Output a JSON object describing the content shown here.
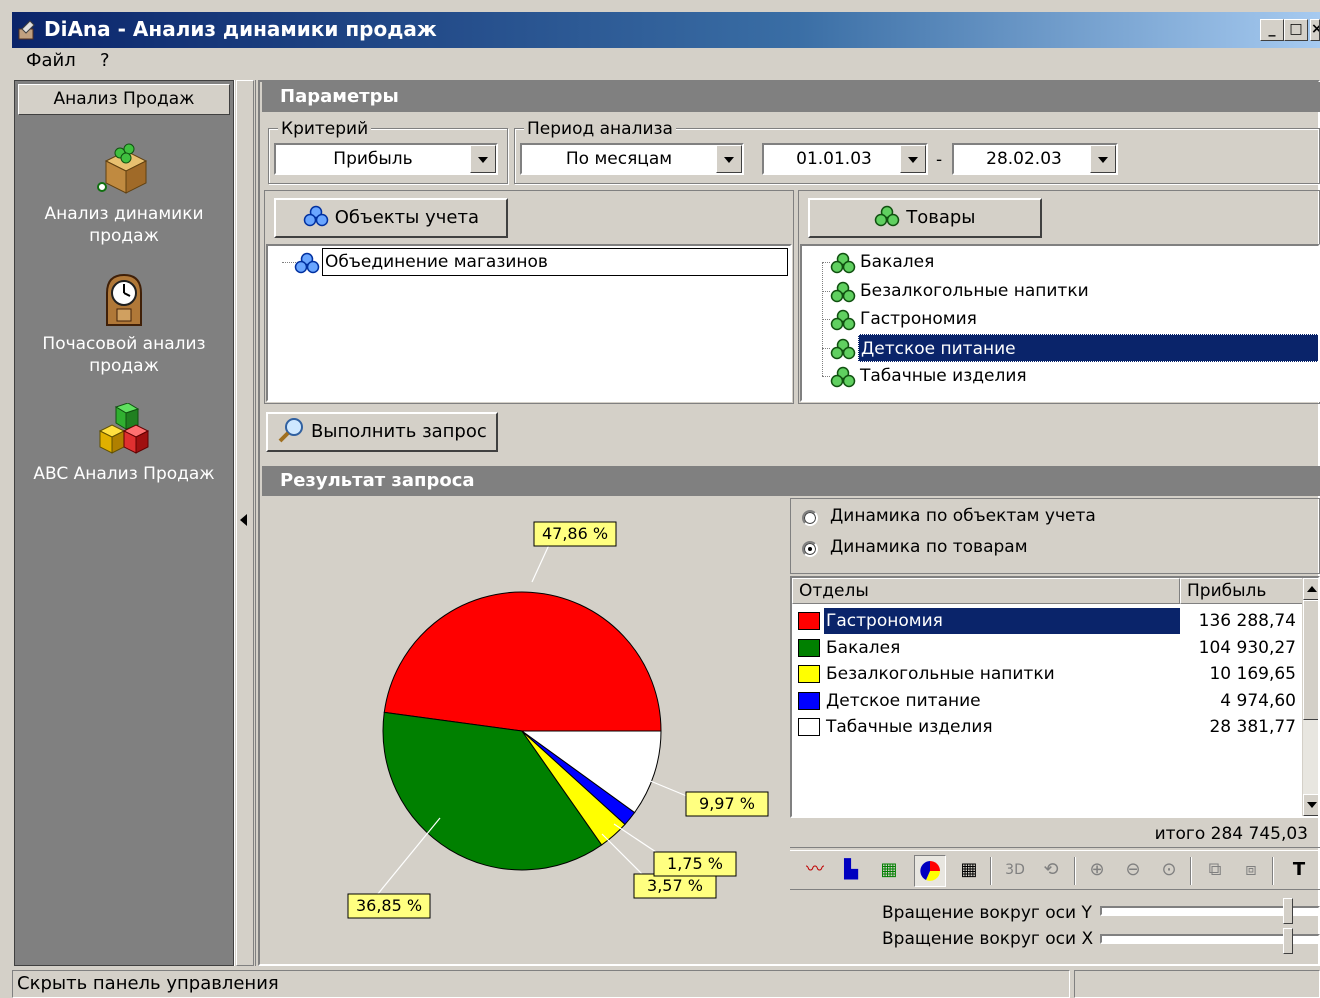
{
  "window": {
    "title": "DiAna - Анализ динамики продаж",
    "controls": {
      "minimize": "_",
      "maximize": "□",
      "close": "×"
    }
  },
  "menu": {
    "items": [
      "Файл",
      "?"
    ]
  },
  "sidebar": {
    "header": "Анализ Продаж",
    "items": [
      {
        "label": "Анализ динамики продаж",
        "icon": "box-icon"
      },
      {
        "label": "Почасовой анализ продаж",
        "icon": "clock-icon"
      },
      {
        "label": "ABC Анализ Продаж",
        "icon": "cubes-icon"
      }
    ]
  },
  "params": {
    "header": "Параметры",
    "criterion": {
      "label": "Критерий",
      "value": "Прибыль"
    },
    "period": {
      "label": "Период анализа",
      "value": "По месяцам"
    },
    "date_from": "01.01.03",
    "date_sep": "-",
    "date_to": "28.02.03",
    "objects_button": "Объекты учета",
    "goods_button": "Товары",
    "objects_tree": [
      "Объединение магазинов"
    ],
    "goods_tree": [
      "Бакалея",
      "Безалкогольные напитки",
      "Гастрономия",
      "Детское питание",
      "Табачные изделия"
    ],
    "goods_selected": "Детское питание",
    "run_button": "Выполнить запрос"
  },
  "result": {
    "header": "Результат запроса",
    "radio_objects": "Динамика по объектам учета",
    "radio_goods": "Динамика по товарам",
    "radio_selected": "goods",
    "grid_header": {
      "name": "Отделы",
      "value": "Прибыль"
    },
    "rows": [
      {
        "name": "Гастрономия",
        "value": "136 288,74",
        "color": "#ff0000",
        "selected": true
      },
      {
        "name": "Бакалея",
        "value": "104 930,27",
        "color": "#008000",
        "selected": false
      },
      {
        "name": "Безалкогольные напитки",
        "value": "10 169,65",
        "color": "#ffff00",
        "selected": false
      },
      {
        "name": "Детское питание",
        "value": "4 974,60",
        "color": "#0000ff",
        "selected": false
      },
      {
        "name": "Табачные изделия",
        "value": "28 381,77",
        "color": "#ffffff",
        "selected": false
      }
    ],
    "total": "итого 284 745,03",
    "rot_y_label": "Вращение вокруг оси Y",
    "rot_x_label": "Вращение вокруг оси X",
    "rot_y_level": 0.85,
    "rot_x_level": 0.85
  },
  "chart_data": {
    "type": "pie",
    "slices": [
      {
        "name": "Гастрономия",
        "percent": 47.86,
        "label": "47,86 %",
        "color": "#ff0000"
      },
      {
        "name": "Бакалея",
        "percent": 36.85,
        "label": "36,85 %",
        "color": "#008000"
      },
      {
        "name": "Безалкогольные напитки",
        "percent": 3.57,
        "label": "3,57 %",
        "color": "#ffff00"
      },
      {
        "name": "Детское питание",
        "percent": 1.75,
        "label": "1,75 %",
        "color": "#0000ff"
      },
      {
        "name": "Табачные изделия",
        "percent": 9.97,
        "label": "9,97 %",
        "color": "#ffffff"
      }
    ]
  },
  "statusbar": {
    "text": "Скрыть панель управления"
  }
}
